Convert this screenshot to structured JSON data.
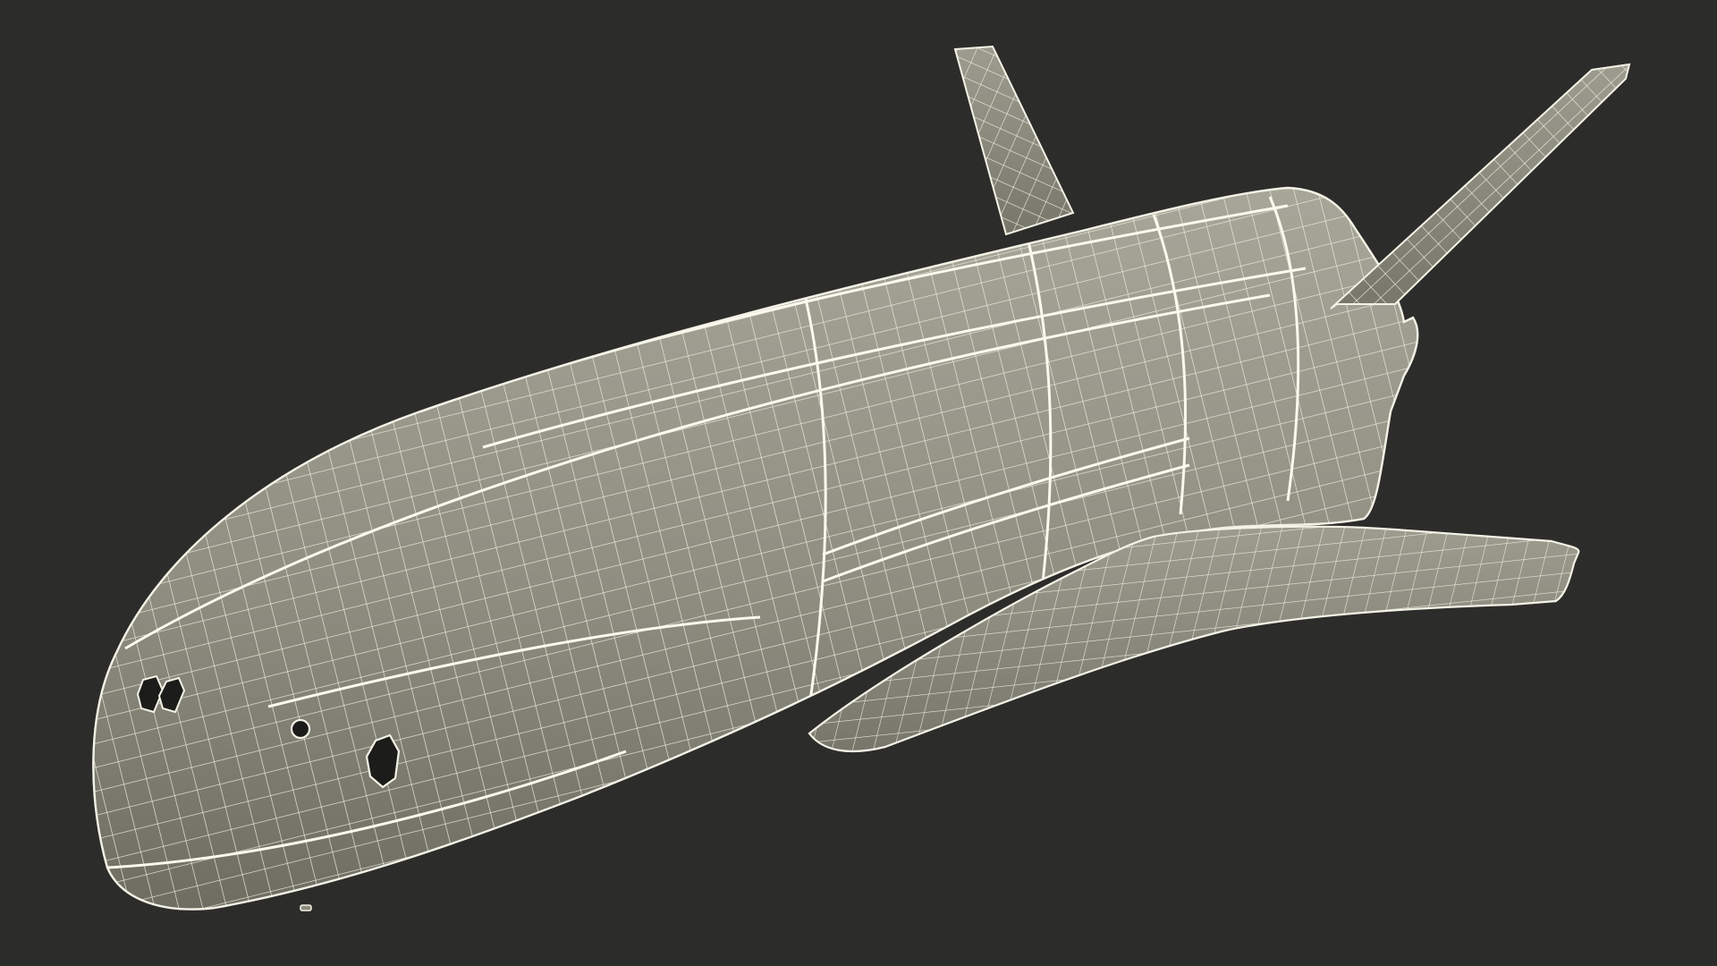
{
  "colors": {
    "background": "#2c2c2a",
    "surface": "#8d8d7f",
    "surface_light": "#a3a396",
    "surface_dark": "#6f6f63",
    "wire": "#f4f2e6",
    "wire_fine": "#e9e7d8",
    "hole": "#1c1c1a"
  },
  "icons": {
    "model": "spaceplane-wireframe-icon"
  }
}
